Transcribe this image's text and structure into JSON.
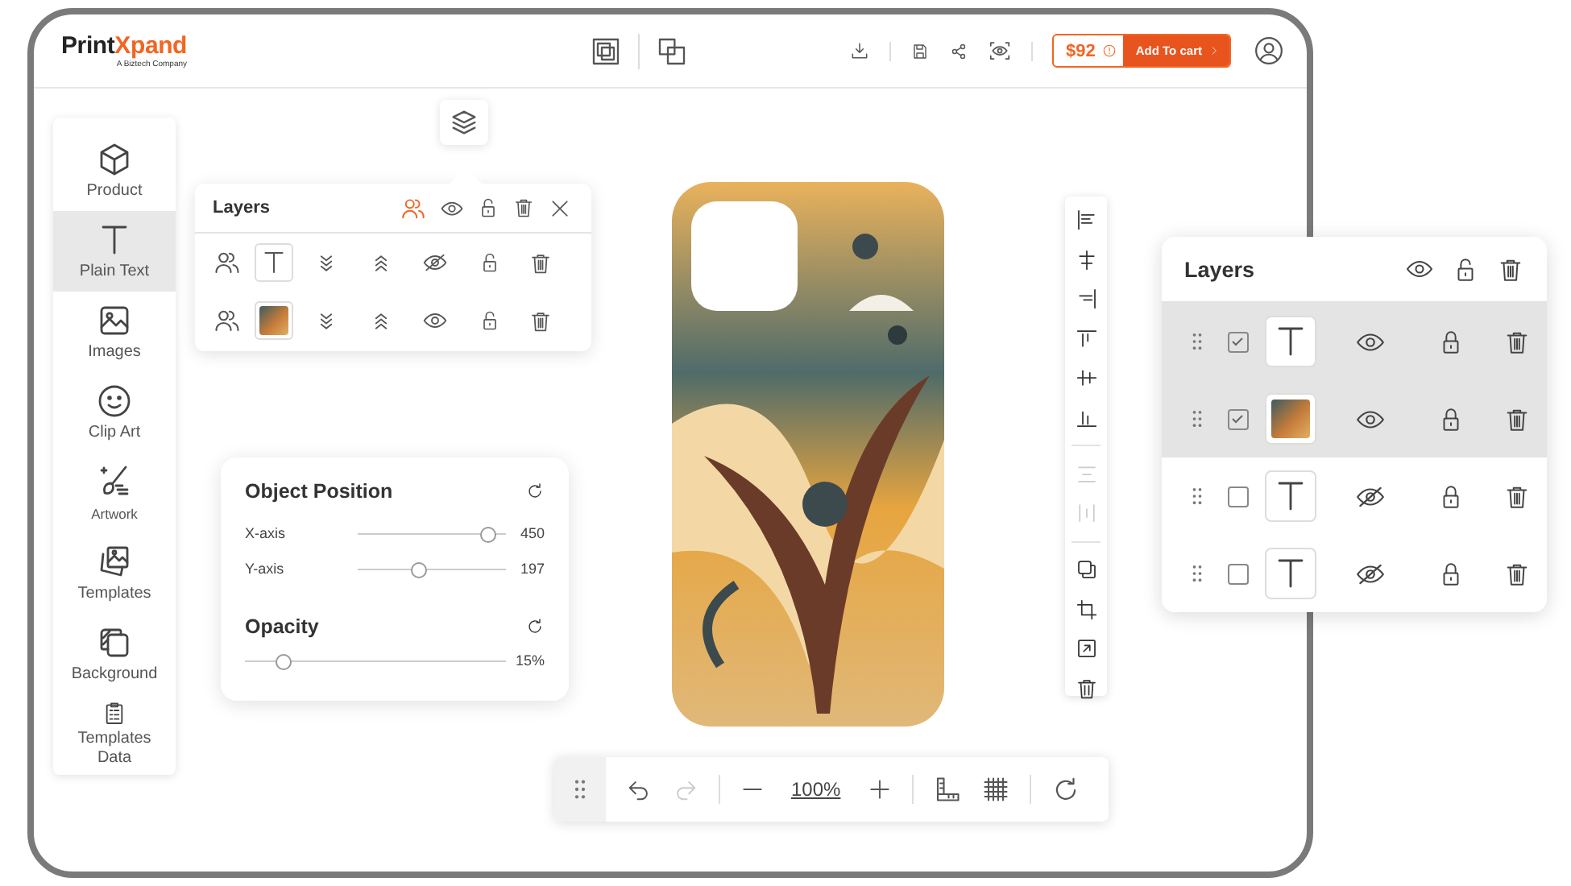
{
  "header": {
    "logo": [
      "Print",
      "Xpand"
    ],
    "tagline": "A Biztech Company",
    "price": "$92",
    "cart_button": "Add To cart"
  },
  "sidebar": {
    "items": [
      {
        "label": "Product",
        "selected": false
      },
      {
        "label": "Plain Text",
        "selected": true
      },
      {
        "label": "Images",
        "selected": false
      },
      {
        "label": "Clip Art",
        "selected": false
      },
      {
        "label": "Artwork",
        "selected": false
      },
      {
        "label": "Templates",
        "selected": false
      },
      {
        "label": "Background",
        "selected": false
      },
      {
        "label": "Templates Data",
        "selected": false
      }
    ]
  },
  "layers_popup": {
    "title": "Layers",
    "rows": [
      {
        "kind": "text",
        "visible": false
      },
      {
        "kind": "image",
        "visible": true
      }
    ]
  },
  "object_position": {
    "title": "Object Position",
    "sliders": [
      {
        "label": "X-axis",
        "level": 0.88,
        "reading": "450"
      },
      {
        "label": "Y-axis",
        "level": 0.41,
        "reading": "197"
      }
    ]
  },
  "opacity": {
    "title": "Opacity",
    "level": 0.15,
    "reading": "15%"
  },
  "align_toolbar": {
    "tools": [
      {
        "kind": "align-left",
        "disabled": false
      },
      {
        "kind": "align-center",
        "disabled": false
      },
      {
        "kind": "align-right",
        "disabled": false
      },
      {
        "kind": "align-top",
        "disabled": false
      },
      {
        "kind": "align-middle",
        "disabled": false
      },
      {
        "kind": "align-bottom",
        "disabled": false
      },
      {
        "kind": "distribute-vertical",
        "disabled": true
      },
      {
        "kind": "distribute-horizontal",
        "disabled": true
      },
      {
        "kind": "duplicate",
        "disabled": false
      },
      {
        "kind": "crop",
        "disabled": false
      },
      {
        "kind": "resize",
        "disabled": false
      },
      {
        "kind": "delete",
        "disabled": false
      }
    ]
  },
  "layers_panel": {
    "title": "Layers",
    "rows": [
      {
        "kind": "text",
        "checked": true,
        "selected": true,
        "visible": true
      },
      {
        "kind": "image",
        "checked": true,
        "selected": true,
        "visible": true
      },
      {
        "kind": "text",
        "checked": false,
        "selected": false,
        "visible": false
      },
      {
        "kind": "text",
        "checked": false,
        "selected": false,
        "visible": false
      }
    ]
  },
  "bottom_toolbar": {
    "zoom": "100%",
    "redo_disabled": true
  }
}
